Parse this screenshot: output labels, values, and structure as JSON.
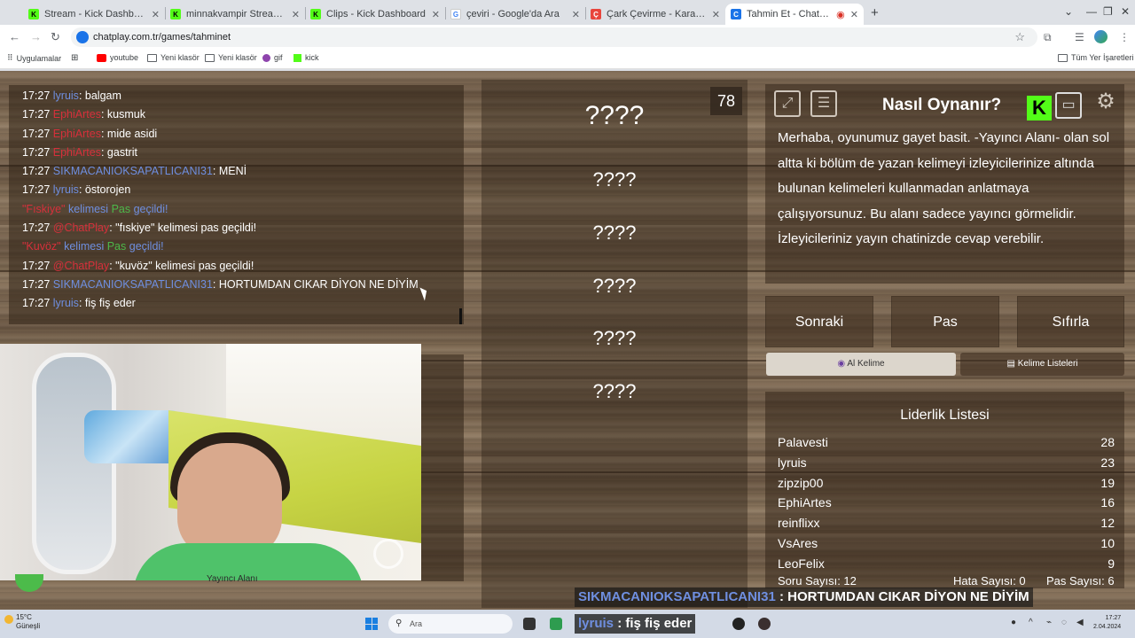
{
  "browser": {
    "tabs": [
      {
        "title": "Stream - Kick Dashboard",
        "favicon_color": "#53fc18",
        "favicon_letter": "K"
      },
      {
        "title": "minnakvampir Stream - Watch",
        "favicon_color": "#53fc18",
        "favicon_letter": "K"
      },
      {
        "title": "Clips - Kick Dashboard",
        "favicon_color": "#53fc18",
        "favicon_letter": "K"
      },
      {
        "title": "çeviri - Google'da Ara",
        "favicon_color": "#4285f4",
        "favicon_letter": "G"
      },
      {
        "title": "Çark Çevirme - Karar Çarkı!",
        "favicon_color": "#e8453c",
        "favicon_letter": "Ç"
      },
      {
        "title": "Tahmin Et - ChatPlay",
        "favicon_color": "#1a73e8",
        "favicon_letter": "C"
      }
    ],
    "url": "chatplay.com.tr/games/tahminet",
    "bookmarks": [
      {
        "label": "Uygulamalar"
      },
      {
        "label": "youtube"
      },
      {
        "label": "Yeni klasör"
      },
      {
        "label": "Yeni klasör"
      },
      {
        "label": "gif"
      },
      {
        "label": "kick"
      }
    ],
    "all_bookmarks": "Tüm Yer İşaretleri"
  },
  "chat": {
    "lines": [
      {
        "time": "17:27",
        "user": "lyruis",
        "user_color": "blue",
        "text": ": balgam"
      },
      {
        "time": "17:27",
        "user": "EphiArtes",
        "user_color": "red",
        "text": ": kusmuk"
      },
      {
        "time": "17:27",
        "user": "EphiArtes",
        "user_color": "red",
        "text": ": mide asidi"
      },
      {
        "time": "17:27",
        "user": "EphiArtes",
        "user_color": "red",
        "text": ": gastrit"
      },
      {
        "time": "17:27",
        "user": "SIKMACANIOKSAPATLICANI31",
        "user_color": "blue",
        "text": ": MENİ"
      },
      {
        "time": "17:27",
        "user": "lyruis",
        "user_color": "blue",
        "text": ": östorojen"
      }
    ],
    "system1": {
      "word": "\"Fıskiye\"",
      "middle": " kelimesi ",
      "pass": "Pas",
      "end": " geçildi!"
    },
    "line_cp1": {
      "time": "17:27",
      "user": "@ChatPlay",
      "text": ": \"fıskiye\" kelimesi pas geçildi!"
    },
    "system2": {
      "word": "\"Kuvöz\"",
      "middle": " kelimesi ",
      "pass": "Pas",
      "end": " geçildi!"
    },
    "line_cp2": {
      "time": "17:27",
      "user": "@ChatPlay",
      "text": ": \"kuvöz\" kelimesi pas geçildi!"
    },
    "line_last1": {
      "time": "17:27",
      "user": "SIKMACANIOKSAPATLICANI31",
      "text": ": HORTUMDAN CIKAR DİYON NE DİYİM"
    },
    "line_last2": {
      "time": "17:27",
      "user": "lyruis",
      "text": ": fiş fiş eder"
    }
  },
  "camera": {
    "label": "Yayıncı Alanı"
  },
  "game": {
    "counter": "78",
    "words": [
      "????",
      "????",
      "????",
      "????",
      "????",
      "????"
    ]
  },
  "howto": {
    "title": "Nasıl Oynanır?",
    "text": "Merhaba, oyunumuz gayet basit. -Yayıncı Alanı- olan sol altta ki bölüm de yazan kelimeyi izleyicilerinize altında bulunan kelimeleri kullanmadan anlatmaya çalışıyorsunuz. Bu alanı sadece yayıncı görmelidir. İzleyicileriniz yayın chatinizde cevap verebilir.",
    "kick_badge": "K"
  },
  "controls": {
    "next": "Sonraki",
    "pass": "Pas",
    "reset": "Sıfırla",
    "ai_word": "Al Kelime",
    "word_lists": "Kelime Listeleri"
  },
  "leaderboard": {
    "title": "Liderlik Listesi",
    "rows": [
      {
        "name": "Palavesti",
        "score": "28"
      },
      {
        "name": "lyruis",
        "score": "23"
      },
      {
        "name": "zipzip00",
        "score": "19"
      },
      {
        "name": "EphiArtes",
        "score": "16"
      },
      {
        "name": "reinflixx",
        "score": "12"
      },
      {
        "name": "VsAres",
        "score": "10"
      },
      {
        "name": "LeoFelix",
        "score": "9"
      }
    ],
    "question_count": "Soru Sayısı: 12",
    "error_count": "Hata Sayısı: 0",
    "pass_count": "Pas Sayısı: 6"
  },
  "overlay": {
    "user": "SIKMACANIOKSAPATLICANI31",
    "text": " : HORTUMDAN CIKAR DİYON NE DİYİM"
  },
  "taskbar": {
    "weather_temp": "15°C",
    "weather_desc": "Güneşli",
    "search": "Ara",
    "overlay_user": "lyruis",
    "overlay_text": " : fiş fiş eder",
    "time": "17:27",
    "date": "2.04.2024"
  }
}
